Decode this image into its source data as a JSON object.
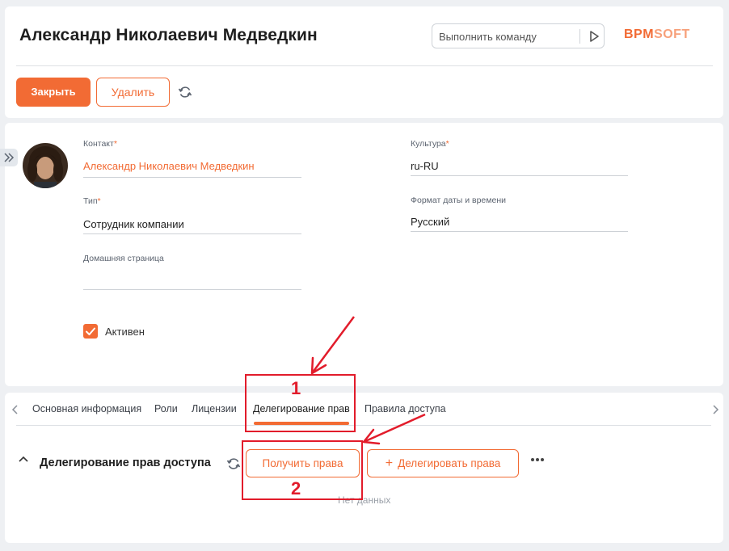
{
  "header": {
    "title": "Александр Николаевич Медведкин",
    "command_placeholder": "Выполнить команду",
    "logo_part1": "BPM",
    "logo_part2": "SOFT",
    "close_label": "Закрыть",
    "delete_label": "Удалить"
  },
  "form": {
    "contact_label": "Контакт",
    "contact_value": "Александр Николаевич Медведкин",
    "type_label": "Тип",
    "type_value": "Сотрудник компании",
    "homepage_label": "Домашняя страница",
    "homepage_value": "",
    "culture_label": "Культура",
    "culture_value": "ru-RU",
    "datetime_format_label": "Формат даты и времени",
    "datetime_format_value": "Русский",
    "required_mark": "*",
    "active_label": "Активен",
    "active_checked": true
  },
  "tabs": [
    {
      "label": "Основная информация"
    },
    {
      "label": "Роли"
    },
    {
      "label": "Лицензии"
    },
    {
      "label": "Делегирование прав"
    },
    {
      "label": "Правила доступа"
    }
  ],
  "active_tab": "Делегирование прав",
  "delegation": {
    "title": "Делегирование прав доступа",
    "get_rights_label": "Получить права",
    "delegate_rights_label": "Делегировать права",
    "no_data": "Нет данных"
  },
  "annotations": {
    "marker1": "1",
    "marker2": "2"
  },
  "colors": {
    "accent": "#f26b34",
    "annotation": "#e21c2b"
  }
}
